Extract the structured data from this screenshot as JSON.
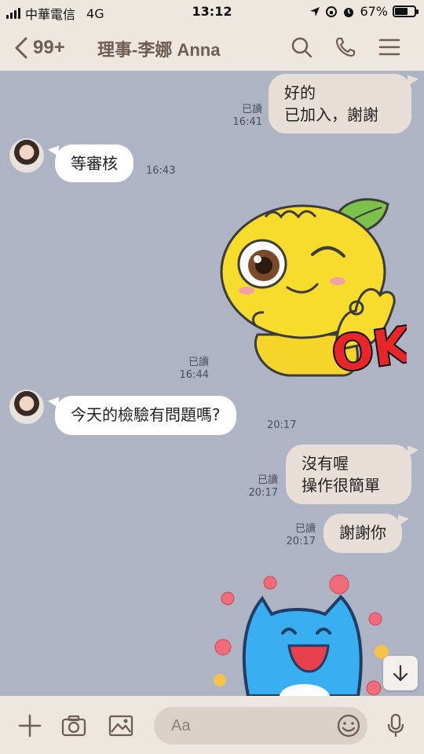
{
  "status_bar": {
    "carrier": "中華電信",
    "network": "4G",
    "time": "13:12",
    "battery": "67%",
    "battery_level": 0.67,
    "icons": [
      "signal-icon",
      "location-icon",
      "lock-rotation-icon",
      "alarm-icon",
      "battery-icon"
    ]
  },
  "header": {
    "back_count": "99+",
    "title": "理事-李娜 Anna",
    "icons": [
      "back-chevron-icon",
      "search-icon",
      "phone-icon",
      "menu-icon"
    ]
  },
  "messages": [
    {
      "direction": "out",
      "lines": [
        "好的",
        "已加入，謝謝"
      ],
      "read": "已讀",
      "time": "16:41"
    },
    {
      "direction": "in",
      "text": "等審核",
      "time": "16:43"
    },
    {
      "direction": "out",
      "sticker": "ok-wink-sticker",
      "sticker_text": "OK",
      "read": "已讀",
      "time": "16:44"
    },
    {
      "direction": "in",
      "text": "今天的檢驗有問題嗎?",
      "time": "20:17"
    },
    {
      "direction": "out",
      "lines": [
        "沒有喔",
        "操作很簡單"
      ],
      "read": "已讀",
      "time": "20:17"
    },
    {
      "direction": "out",
      "text": "謝謝你",
      "read": "已讀",
      "time": "20:17"
    },
    {
      "direction": "out",
      "sticker": "blue-cat-flowers-sticker"
    }
  ],
  "footer": {
    "placeholder": "Aa",
    "icons": [
      "plus-icon",
      "camera-icon",
      "image-icon",
      "emoji-icon",
      "mic-icon"
    ]
  },
  "colors": {
    "chat_bg": "#aeb4c4",
    "header_bg": "#eee7df",
    "outgoing_bubble": "#e7dfd7",
    "incoming_bubble": "#ffffff",
    "header_text": "#6e5e52"
  }
}
